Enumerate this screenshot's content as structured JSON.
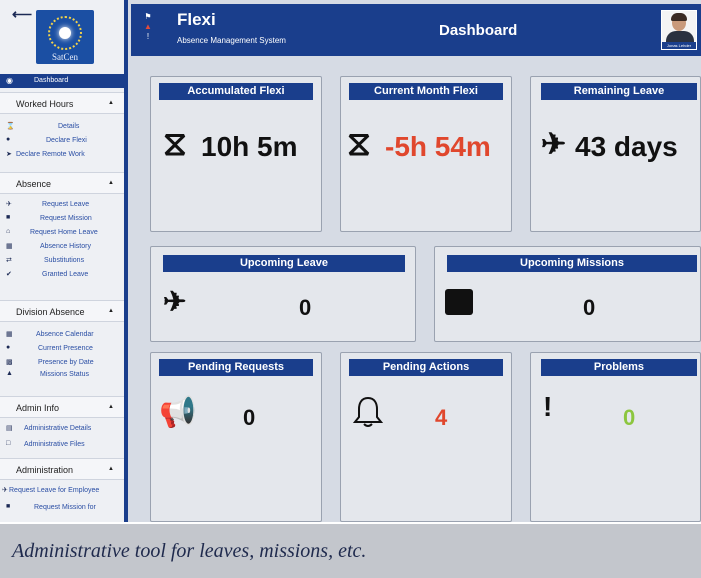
{
  "app": {
    "title": "Flexi",
    "subtitle": "Absence Management System",
    "page_title": "Dashboard",
    "logo_text": "SatCen",
    "back_icon": "arrow-left-icon",
    "user_name": "Jonas Lehder",
    "header_icons": [
      "megaphone-icon",
      "bell-icon",
      "exclamation-icon"
    ]
  },
  "sidebar": {
    "active_item": {
      "label": "Dashboard",
      "icon": "dashboard-icon"
    },
    "sections": [
      {
        "label": "Worked Hours",
        "items": [
          {
            "label": "Details",
            "icon": "hourglass-icon"
          },
          {
            "label": "Declare Flexi",
            "icon": "dot-icon"
          },
          {
            "label": "Declare Remote Work",
            "icon": "rocket-icon"
          }
        ]
      },
      {
        "label": "Absence",
        "items": [
          {
            "label": "Request Leave",
            "icon": "plane-icon"
          },
          {
            "label": "Request Mission",
            "icon": "briefcase-icon"
          },
          {
            "label": "Request Home Leave",
            "icon": "home-icon"
          },
          {
            "label": "Absence History",
            "icon": "calendar-icon"
          },
          {
            "label": "Substitutions",
            "icon": "swap-icon"
          },
          {
            "label": "Granted Leave",
            "icon": "check-icon"
          }
        ]
      },
      {
        "label": "Division Absence",
        "items": [
          {
            "label": "Absence Calendar",
            "icon": "calendar-icon"
          },
          {
            "label": "Current Presence",
            "icon": "dot-icon"
          },
          {
            "label": "Presence by Date",
            "icon": "presence-icon"
          },
          {
            "label": "Missions Status",
            "icon": "status-icon"
          }
        ]
      },
      {
        "label": "Admin Info",
        "items": [
          {
            "label": "Administrative Details",
            "icon": "id-card-icon"
          },
          {
            "label": "Administrative Files",
            "icon": "file-icon"
          }
        ]
      },
      {
        "label": "Administration",
        "items": [
          {
            "label": "Request Leave for Employee",
            "icon": "plane-icon"
          },
          {
            "label": "Request Mission for",
            "icon": "briefcase-icon"
          }
        ]
      }
    ]
  },
  "cards": {
    "accumulated_flexi": {
      "title": "Accumulated Flexi",
      "value": "10h 5m",
      "icon": "hourglass-icon",
      "color": "#111111"
    },
    "current_month_flexi": {
      "title": "Current Month Flexi",
      "value": "-5h 54m",
      "icon": "hourglass-icon",
      "color": "#e0472d"
    },
    "remaining_leave": {
      "title": "Remaining Leave",
      "value": "43 days",
      "icon": "plane-icon",
      "color": "#111111"
    },
    "upcoming_leave": {
      "title": "Upcoming Leave",
      "value": "0",
      "icon": "plane-icon",
      "color": "#111111"
    },
    "upcoming_missions": {
      "title": "Upcoming Missions",
      "value": "0",
      "icon": "briefcase-icon",
      "color": "#111111"
    },
    "pending_requests": {
      "title": "Pending Requests",
      "value": "0",
      "icon": "megaphone-icon",
      "color": "#111111"
    },
    "pending_actions": {
      "title": "Pending Actions",
      "value": "4",
      "icon": "bell-icon",
      "color": "#e0472d"
    },
    "problems": {
      "title": "Problems",
      "value": "0",
      "icon": "exclamation-icon",
      "color": "#8cc63f"
    }
  },
  "caption": "Administrative tool for leaves, missions, etc."
}
